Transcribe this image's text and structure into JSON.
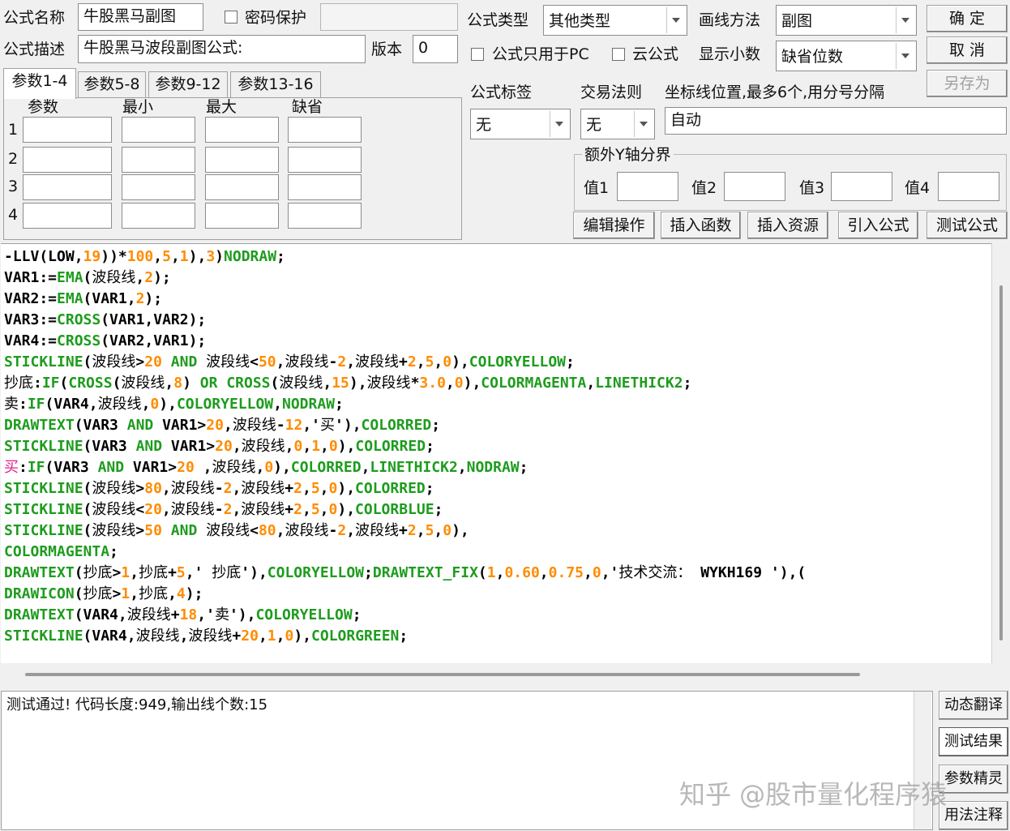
{
  "form": {
    "name_label": "公式名称",
    "name_value": "牛股黑马副图",
    "password_label": "密码保护",
    "desc_label": "公式描述",
    "desc_value": "牛股黑马波段副图公式:",
    "version_label": "版本",
    "version_value": "0",
    "type_label": "公式类型",
    "type_value": "其他类型",
    "draw_label": "画线方法",
    "draw_value": "副图",
    "pc_only_label": "公式只用于PC",
    "cloud_label": "云公式",
    "decimals_label": "显示小数",
    "decimals_value": "缺省位数",
    "tag_label": "公式标签",
    "tag_value": "无",
    "rule_label": "交易法则",
    "rule_value": "无",
    "coord_label": "坐标线位置,最多6个,用分号分隔",
    "coord_value": "自动",
    "extra_y_label": "额外Y轴分界",
    "val_labels": [
      "值1",
      "值2",
      "值3",
      "值4"
    ]
  },
  "buttons": {
    "ok": "确  定",
    "cancel": "取  消",
    "save_as": "另存为",
    "edit": "编辑操作",
    "insert_func": "插入函数",
    "insert_res": "插入资源",
    "import": "引入公式",
    "test": "测试公式",
    "translate": "动态翻译",
    "test_result": "测试结果",
    "param_wizard": "参数精灵",
    "usage": "用法注释"
  },
  "params": {
    "tabs": [
      "参数1-4",
      "参数5-8",
      "参数9-12",
      "参数13-16"
    ],
    "headers": [
      "参数",
      "最小",
      "最大",
      "缺省"
    ],
    "rows": [
      "1",
      "2",
      "3",
      "4"
    ]
  },
  "code_lines": [
    [
      [
        "-LLV(LOW,",
        "t"
      ],
      [
        "19",
        "n"
      ],
      [
        "))*",
        "t"
      ],
      [
        "100",
        "n"
      ],
      [
        ",",
        "t"
      ],
      [
        "5",
        "n"
      ],
      [
        ",",
        "t"
      ],
      [
        "1",
        "n"
      ],
      [
        "),",
        "t"
      ],
      [
        "3",
        "n"
      ],
      [
        ")",
        "t"
      ],
      [
        "NODRAW",
        "k"
      ],
      [
        ";",
        "t"
      ]
    ],
    [
      [
        "VAR1:=",
        "t"
      ],
      [
        "EMA",
        "k"
      ],
      [
        "(",
        "t"
      ],
      [
        "波段线",
        "c"
      ],
      [
        ",",
        "t"
      ],
      [
        "2",
        "n"
      ],
      [
        ");",
        "t"
      ]
    ],
    [
      [
        "VAR2:=",
        "t"
      ],
      [
        "EMA",
        "k"
      ],
      [
        "(VAR1,",
        "t"
      ],
      [
        "2",
        "n"
      ],
      [
        ");",
        "t"
      ]
    ],
    [
      [
        "VAR3:=",
        "t"
      ],
      [
        "CROSS",
        "k"
      ],
      [
        "(VAR1,VAR2);",
        "t"
      ]
    ],
    [
      [
        "VAR4:=",
        "t"
      ],
      [
        "CROSS",
        "k"
      ],
      [
        "(VAR2,VAR1);",
        "t"
      ]
    ],
    [
      [
        "STICKLINE",
        "k"
      ],
      [
        "(",
        "t"
      ],
      [
        "波段线",
        "c"
      ],
      [
        ">",
        "t"
      ],
      [
        "20",
        "n"
      ],
      [
        " ",
        "t"
      ],
      [
        "AND",
        "k"
      ],
      [
        " ",
        "t"
      ],
      [
        "波段线",
        "c"
      ],
      [
        "<",
        "t"
      ],
      [
        "50",
        "n"
      ],
      [
        ",",
        "t"
      ],
      [
        "波段线",
        "c"
      ],
      [
        "-",
        "t"
      ],
      [
        "2",
        "n"
      ],
      [
        ",",
        "t"
      ],
      [
        "波段线",
        "c"
      ],
      [
        "+",
        "t"
      ],
      [
        "2",
        "n"
      ],
      [
        ",",
        "t"
      ],
      [
        "5",
        "n"
      ],
      [
        ",",
        "t"
      ],
      [
        "0",
        "n"
      ],
      [
        "),",
        "t"
      ],
      [
        "COLORYELLOW",
        "k"
      ],
      [
        ";",
        "t"
      ]
    ],
    [
      [
        "抄底",
        "c"
      ],
      [
        ":",
        "t"
      ],
      [
        "IF",
        "k"
      ],
      [
        "(",
        "t"
      ],
      [
        "CROSS",
        "k"
      ],
      [
        "(",
        "t"
      ],
      [
        "波段线",
        "c"
      ],
      [
        ",",
        "t"
      ],
      [
        "8",
        "n"
      ],
      [
        ") ",
        "t"
      ],
      [
        "OR",
        "k"
      ],
      [
        " ",
        "t"
      ],
      [
        "CROSS",
        "k"
      ],
      [
        "(",
        "t"
      ],
      [
        "波段线",
        "c"
      ],
      [
        ",",
        "t"
      ],
      [
        "15",
        "n"
      ],
      [
        "),",
        "t"
      ],
      [
        "波段线",
        "c"
      ],
      [
        "*",
        "t"
      ],
      [
        "3.0",
        "n"
      ],
      [
        ",",
        "t"
      ],
      [
        "0",
        "n"
      ],
      [
        "),",
        "t"
      ],
      [
        "COLORMAGENTA",
        "k"
      ],
      [
        ",",
        "t"
      ],
      [
        "LINETHICK2",
        "k"
      ],
      [
        ";",
        "t"
      ]
    ],
    [
      [
        "卖",
        "c"
      ],
      [
        ":",
        "t"
      ],
      [
        "IF",
        "k"
      ],
      [
        "(VAR4,",
        "t"
      ],
      [
        "波段线",
        "c"
      ],
      [
        ",",
        "t"
      ],
      [
        "0",
        "n"
      ],
      [
        "),",
        "t"
      ],
      [
        "COLORYELLOW",
        "k"
      ],
      [
        ",",
        "t"
      ],
      [
        "NODRAW",
        "k"
      ],
      [
        ";",
        "t"
      ]
    ],
    [
      [
        "DRAWTEXT",
        "k"
      ],
      [
        "(VAR3 ",
        "t"
      ],
      [
        "AND",
        "k"
      ],
      [
        " VAR1>",
        "t"
      ],
      [
        "20",
        "n"
      ],
      [
        ",",
        "t"
      ],
      [
        "波段线",
        "c"
      ],
      [
        "-",
        "t"
      ],
      [
        "12",
        "n"
      ],
      [
        ",'",
        "t"
      ],
      [
        "买",
        "c"
      ],
      [
        "'),",
        "t"
      ],
      [
        "COLORRED",
        "k"
      ],
      [
        ";",
        "t"
      ]
    ],
    [
      [
        "STICKLINE",
        "k"
      ],
      [
        "(VAR3 ",
        "t"
      ],
      [
        "AND",
        "k"
      ],
      [
        " VAR1>",
        "t"
      ],
      [
        "20",
        "n"
      ],
      [
        ",",
        "t"
      ],
      [
        "波段线",
        "c"
      ],
      [
        ",",
        "t"
      ],
      [
        "0",
        "n"
      ],
      [
        ",",
        "t"
      ],
      [
        "1",
        "n"
      ],
      [
        ",",
        "t"
      ],
      [
        "0",
        "n"
      ],
      [
        "),",
        "t"
      ],
      [
        "COLORRED",
        "k"
      ],
      [
        ";",
        "t"
      ]
    ],
    [
      [
        "买",
        "m"
      ],
      [
        ":",
        "t"
      ],
      [
        "IF",
        "k"
      ],
      [
        "(VAR3 ",
        "t"
      ],
      [
        "AND",
        "k"
      ],
      [
        " VAR1>",
        "t"
      ],
      [
        "20",
        "n"
      ],
      [
        " ,",
        "t"
      ],
      [
        "波段线",
        "c"
      ],
      [
        ",",
        "t"
      ],
      [
        "0",
        "n"
      ],
      [
        "),",
        "t"
      ],
      [
        "COLORRED",
        "k"
      ],
      [
        ",",
        "t"
      ],
      [
        "LINETHICK2",
        "k"
      ],
      [
        ",",
        "t"
      ],
      [
        "NODRAW",
        "k"
      ],
      [
        ";",
        "t"
      ]
    ],
    [
      [
        "STICKLINE",
        "k"
      ],
      [
        "(",
        "t"
      ],
      [
        "波段线",
        "c"
      ],
      [
        ">",
        "t"
      ],
      [
        "80",
        "n"
      ],
      [
        ",",
        "t"
      ],
      [
        "波段线",
        "c"
      ],
      [
        "-",
        "t"
      ],
      [
        "2",
        "n"
      ],
      [
        ",",
        "t"
      ],
      [
        "波段线",
        "c"
      ],
      [
        "+",
        "t"
      ],
      [
        "2",
        "n"
      ],
      [
        ",",
        "t"
      ],
      [
        "5",
        "n"
      ],
      [
        ",",
        "t"
      ],
      [
        "0",
        "n"
      ],
      [
        "),",
        "t"
      ],
      [
        "COLORRED",
        "k"
      ],
      [
        ";",
        "t"
      ]
    ],
    [
      [
        "STICKLINE",
        "k"
      ],
      [
        "(",
        "t"
      ],
      [
        "波段线",
        "c"
      ],
      [
        "<",
        "t"
      ],
      [
        "20",
        "n"
      ],
      [
        ",",
        "t"
      ],
      [
        "波段线",
        "c"
      ],
      [
        "-",
        "t"
      ],
      [
        "2",
        "n"
      ],
      [
        ",",
        "t"
      ],
      [
        "波段线",
        "c"
      ],
      [
        "+",
        "t"
      ],
      [
        "2",
        "n"
      ],
      [
        ",",
        "t"
      ],
      [
        "5",
        "n"
      ],
      [
        ",",
        "t"
      ],
      [
        "0",
        "n"
      ],
      [
        "),",
        "t"
      ],
      [
        "COLORBLUE",
        "k"
      ],
      [
        ";",
        "t"
      ]
    ],
    [
      [
        "STICKLINE",
        "k"
      ],
      [
        "(",
        "t"
      ],
      [
        "波段线",
        "c"
      ],
      [
        ">",
        "t"
      ],
      [
        "50",
        "n"
      ],
      [
        " ",
        "t"
      ],
      [
        "AND",
        "k"
      ],
      [
        " ",
        "t"
      ],
      [
        "波段线",
        "c"
      ],
      [
        "<",
        "t"
      ],
      [
        "80",
        "n"
      ],
      [
        ",",
        "t"
      ],
      [
        "波段线",
        "c"
      ],
      [
        "-",
        "t"
      ],
      [
        "2",
        "n"
      ],
      [
        ",",
        "t"
      ],
      [
        "波段线",
        "c"
      ],
      [
        "+",
        "t"
      ],
      [
        "2",
        "n"
      ],
      [
        ",",
        "t"
      ],
      [
        "5",
        "n"
      ],
      [
        ",",
        "t"
      ],
      [
        "0",
        "n"
      ],
      [
        "),",
        "t"
      ]
    ],
    [
      [
        "COLORMAGENTA",
        "k"
      ],
      [
        ";",
        "t"
      ]
    ],
    [
      [
        "DRAWTEXT",
        "k"
      ],
      [
        "(",
        "t"
      ],
      [
        "抄底",
        "c"
      ],
      [
        ">",
        "t"
      ],
      [
        "1",
        "n"
      ],
      [
        ",",
        "t"
      ],
      [
        "抄底",
        "c"
      ],
      [
        "+",
        "t"
      ],
      [
        "5",
        "n"
      ],
      [
        ",' ",
        "t"
      ],
      [
        "抄底",
        "c"
      ],
      [
        "'),",
        "t"
      ],
      [
        "COLORYELLOW",
        "k"
      ],
      [
        ";",
        "t"
      ],
      [
        "DRAWTEXT_FIX",
        "k"
      ],
      [
        "(",
        "t"
      ],
      [
        "1",
        "n"
      ],
      [
        ",",
        "t"
      ],
      [
        "0.60",
        "n"
      ],
      [
        ",",
        "t"
      ],
      [
        "0.75",
        "n"
      ],
      [
        ",",
        "t"
      ],
      [
        "0",
        "n"
      ],
      [
        ",'",
        "t"
      ],
      [
        "技术交流：",
        "c"
      ],
      [
        " WYKH169 '),(",
        "t"
      ]
    ],
    [
      [
        "DRAWICON",
        "k"
      ],
      [
        "(",
        "t"
      ],
      [
        "抄底",
        "c"
      ],
      [
        ">",
        "t"
      ],
      [
        "1",
        "n"
      ],
      [
        ",",
        "t"
      ],
      [
        "抄底",
        "c"
      ],
      [
        ",",
        "t"
      ],
      [
        "4",
        "n"
      ],
      [
        ");",
        "t"
      ]
    ],
    [
      [
        "DRAWTEXT",
        "k"
      ],
      [
        "(VAR4,",
        "t"
      ],
      [
        "波段线",
        "c"
      ],
      [
        "+",
        "t"
      ],
      [
        "18",
        "n"
      ],
      [
        ",'",
        "t"
      ],
      [
        "卖",
        "c"
      ],
      [
        "'),",
        "t"
      ],
      [
        "COLORYELLOW",
        "k"
      ],
      [
        ";",
        "t"
      ]
    ],
    [
      [
        "STICKLINE",
        "k"
      ],
      [
        "(VAR4,",
        "t"
      ],
      [
        "波段线",
        "c"
      ],
      [
        ",",
        "t"
      ],
      [
        "波段线",
        "c"
      ],
      [
        "+",
        "t"
      ],
      [
        "20",
        "n"
      ],
      [
        ",",
        "t"
      ],
      [
        "1",
        "n"
      ],
      [
        ",",
        "t"
      ],
      [
        "0",
        "n"
      ],
      [
        "),",
        "t"
      ],
      [
        "COLORGREEN",
        "k"
      ],
      [
        ";",
        "t"
      ]
    ]
  ],
  "status_text": "测试通过! 代码长度:949,输出线个数:15",
  "watermark": "知乎 @股市量化程序猿",
  "colors": {
    "keyword": "#1e9c1e",
    "number": "#ff8c00",
    "magenta_text": "#e0218a"
  }
}
